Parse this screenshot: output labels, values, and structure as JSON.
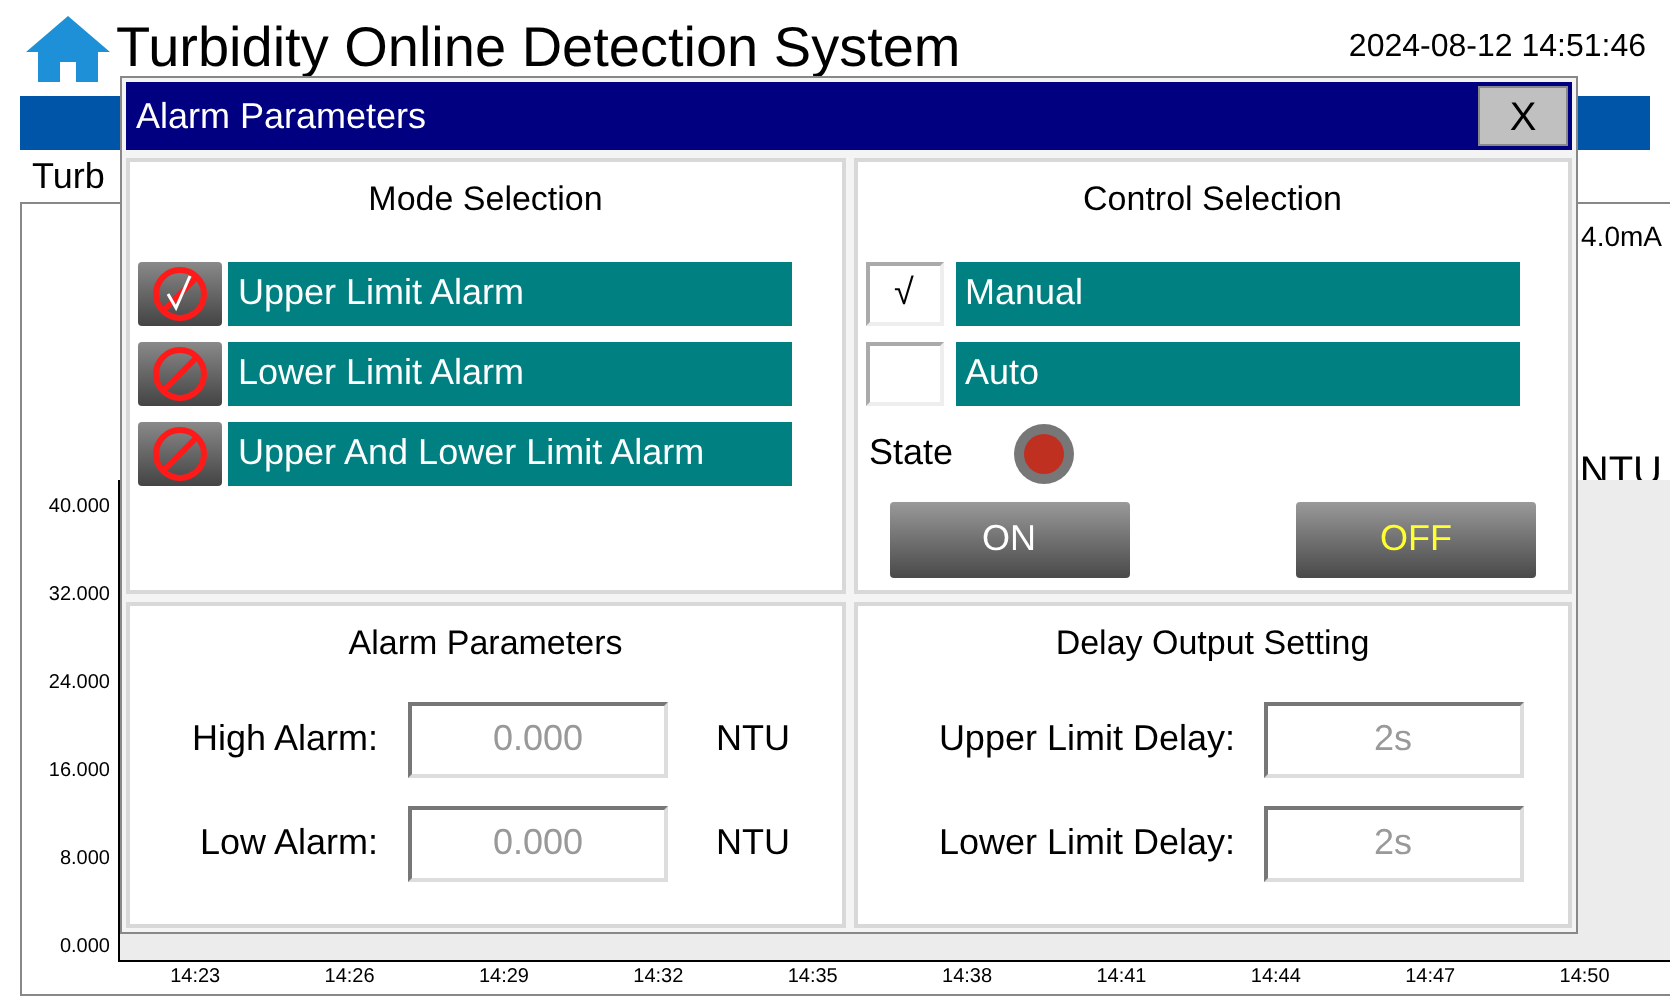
{
  "header": {
    "title": "Turbidity Online Detection System",
    "datetime": "2024-08-12 14:51:46"
  },
  "background": {
    "label": "Turb",
    "reading": "4.0mA",
    "unit": "NTU",
    "yticks": [
      "40.000",
      "32.000",
      "24.000",
      "16.000",
      "8.000",
      "0.000"
    ],
    "xticks": [
      "14:23",
      "14:26",
      "14:29",
      "14:32",
      "14:35",
      "14:38",
      "14:41",
      "14:44",
      "14:47",
      "14:50"
    ]
  },
  "dialog": {
    "title": "Alarm Parameters",
    "close": "X",
    "mode_selection": {
      "title": "Mode Selection",
      "items": [
        {
          "label": "Upper Limit Alarm",
          "selected": true
        },
        {
          "label": "Lower Limit Alarm",
          "selected": false
        },
        {
          "label": "Upper And Lower Limit Alarm",
          "selected": false
        }
      ]
    },
    "control_selection": {
      "title": "Control Selection",
      "check_mark": "√",
      "items": [
        {
          "label": "Manual",
          "checked": true
        },
        {
          "label": "Auto",
          "checked": false
        }
      ],
      "state_label": "State",
      "state_lit": true,
      "buttons": [
        {
          "label": "ON",
          "selected": false
        },
        {
          "label": "OFF",
          "selected": true
        }
      ]
    },
    "alarm_parameters": {
      "title": "Alarm Parameters",
      "fields": [
        {
          "label": "High Alarm:",
          "value": "0.000",
          "unit": "NTU"
        },
        {
          "label": "Low Alarm:",
          "value": "0.000",
          "unit": "NTU"
        }
      ]
    },
    "delay_output": {
      "title": "Delay Output Setting",
      "fields": [
        {
          "label": "Upper Limit Delay:",
          "value": "2s"
        },
        {
          "label": "Lower Limit Delay:",
          "value": "2s"
        }
      ]
    }
  }
}
